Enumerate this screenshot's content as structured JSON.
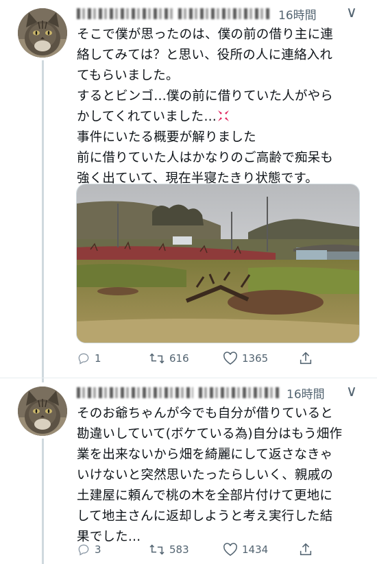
{
  "tweets": [
    {
      "time": "16時間",
      "lines": [
        "そこで僕が思ったのは、僕の前の借り主に連",
        "絡してみては？と思い、役所の人に連絡入れ",
        "てもらいました。",
        "するとビンゴ…僕の前に借りていた人がやら",
        "かしてくれていました…",
        "事件にいたる概要が解りました",
        "前に借りていた人はかなりのご高齢で痴呆も",
        "強く出ていて、現在半寝たきり状態です。"
      ],
      "reply_count": "1",
      "retweet_count": "616",
      "like_count": "1365"
    },
    {
      "time": "16時間",
      "lines": [
        "そのお爺ちゃんが今でも自分が借りていると",
        "勘違いしていて(ボケている為)自分はもう畑作",
        "業を出来ないから畑を綺麗にして返さなきゃ",
        "いけないと突然思いたったらしいく、親戚の",
        "土建屋に頼んで桃の木を全部片付けて更地に",
        "して地主さんに返却しようと考え実行した結",
        "果でした…"
      ],
      "reply_count": "3",
      "retweet_count": "583",
      "like_count": "1434"
    }
  ],
  "icons": {
    "reply": "reply-icon",
    "retweet": "retweet-icon",
    "like": "heart-icon",
    "share": "share-icon",
    "more": "more-icon",
    "anger": "anger-emoji-icon"
  },
  "colors": {
    "text": "#0f1419",
    "muted": "#536471",
    "thread_line": "#cfd9de"
  }
}
